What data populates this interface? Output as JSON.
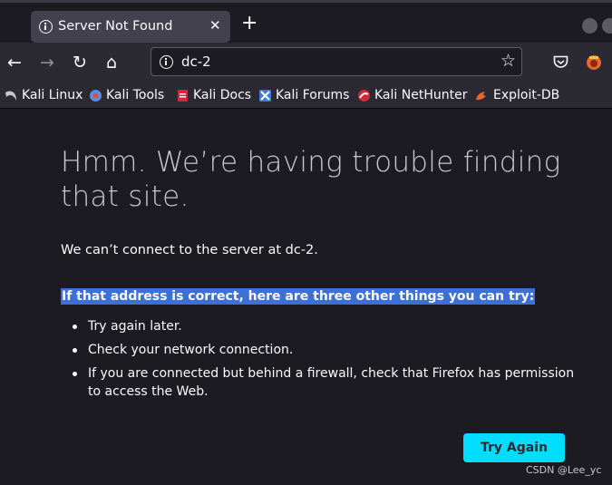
{
  "tab": {
    "title": "Server Not Found",
    "close": "✕"
  },
  "newtab": "+",
  "nav": {
    "back": "←",
    "forward": "→",
    "reload": "↻",
    "home": "⌂"
  },
  "urlbar": {
    "value": "dc-2",
    "star": "☆"
  },
  "bookmarks": [
    {
      "label": "Kali Linux",
      "icon": "kali-dragon-icon",
      "color": "#9a9aa5"
    },
    {
      "label": "Kali Tools",
      "icon": "kali-tools-icon",
      "color": "#5b8ce0"
    },
    {
      "label": "Kali Docs",
      "icon": "kali-docs-icon",
      "color": "#d3283b"
    },
    {
      "label": "Kali Forums",
      "icon": "kali-forums-icon",
      "color": "#3d7ae0"
    },
    {
      "label": "Kali NetHunter",
      "icon": "nethunter-icon",
      "color": "#d3283b"
    },
    {
      "label": "Exploit-DB",
      "icon": "exploit-db-icon",
      "color": "#e8662a"
    }
  ],
  "error": {
    "title": "Hmm. We’re having trouble finding that site.",
    "description": "We can’t connect to the server at dc-2.",
    "hint": "If that address is correct, here are three other things you can try:",
    "steps": [
      "Try again later.",
      "Check your network connection.",
      "If you are connected but behind a firewall, check that Firefox has permission to access the Web."
    ],
    "try_again": "Try Again"
  },
  "watermark": "CSDN @Lee_yc",
  "colors": {
    "accent": "#00ddff",
    "selection": "#3d6fd5",
    "background": "#1c1b22",
    "toolbar": "#2b2a33"
  }
}
